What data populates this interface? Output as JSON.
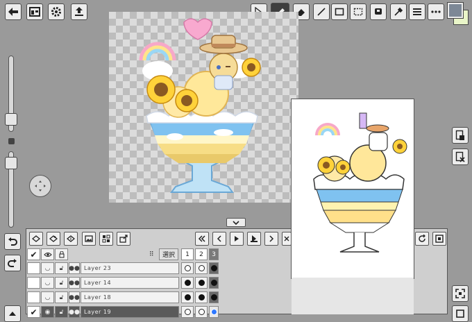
{
  "layers_header": {
    "select_label": "選択",
    "col1": "1",
    "col2": "2",
    "col3": "3"
  },
  "layers": [
    {
      "name": "Layer 23",
      "checked": false,
      "dots": [
        "o",
        "o",
        "f"
      ]
    },
    {
      "name": "Layer 14",
      "checked": false,
      "dots": [
        "f",
        "f",
        "f"
      ]
    },
    {
      "name": "Layer 18",
      "checked": false,
      "dots": [
        "f",
        "f",
        "f"
      ]
    },
    {
      "name": "Layer 19",
      "checked": true,
      "dots": [
        "o",
        "o",
        "b"
      ]
    }
  ],
  "colors": {
    "foreground": "#7d8896",
    "background": "#e9f5c8",
    "selected_row": "#5a5a5a",
    "accent": "#2e78ff"
  },
  "icons": {
    "top_left": [
      "exit-icon",
      "screen-layout-icon",
      "settings-gear-icon",
      "share-upload-icon"
    ],
    "top_right": [
      "select-arrow-icon",
      "pencil-icon",
      "eraser-icon",
      "line-icon",
      "rectangle-icon",
      "marquee-select-icon",
      "bucket-fill-icon",
      "eyedropper-icon",
      "menu-icon",
      "more-icon"
    ],
    "transport": [
      "first-frame-icon",
      "prev-frame-icon",
      "play-icon",
      "onion-skin-icon",
      "next-frame-icon"
    ]
  }
}
